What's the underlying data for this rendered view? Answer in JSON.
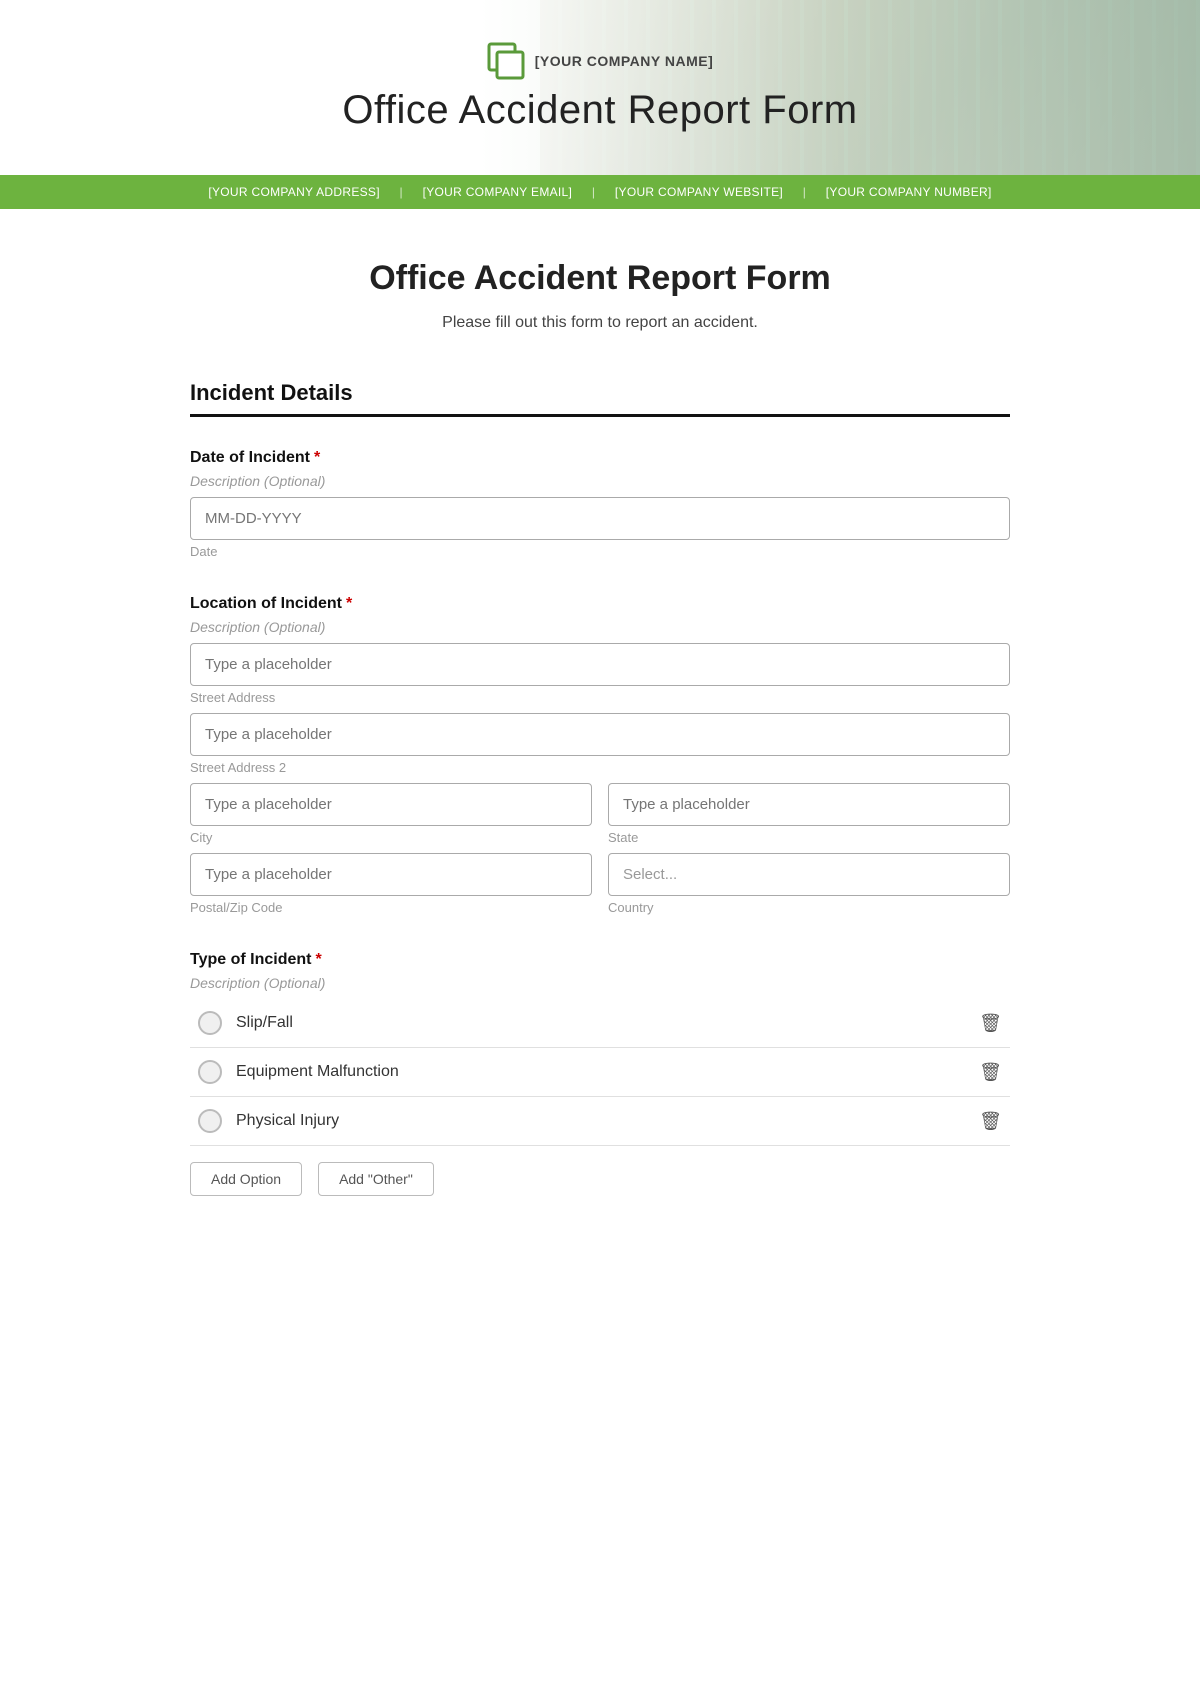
{
  "header": {
    "company_name": "[YOUR COMPANY NAME]",
    "title": "Office Accident Report Form",
    "company_address": "[YOUR COMPANY ADDRESS]",
    "company_email": "[YOUR COMPANY EMAIL]",
    "company_website": "[YOUR COMPANY WEBSITE]",
    "company_number": "[YOUR COMPANY NUMBER]",
    "separator": "|"
  },
  "form": {
    "title": "Office Accident Report Form",
    "subtitle": "Please fill out this form to report an accident.",
    "section_incident": "Incident Details",
    "date_field": {
      "label": "Date of Incident",
      "required": true,
      "description": "Description (Optional)",
      "placeholder": "MM-DD-YYYY",
      "sublabel": "Date"
    },
    "location_field": {
      "label": "Location of Incident",
      "required": true,
      "description": "Description (Optional)",
      "street1_placeholder": "Type a placeholder",
      "street1_sublabel": "Street Address",
      "street2_placeholder": "Type a placeholder",
      "street2_sublabel": "Street Address 2",
      "city_placeholder": "Type a placeholder",
      "city_sublabel": "City",
      "state_placeholder": "Type a placeholder",
      "state_sublabel": "State",
      "zip_placeholder": "Type a placeholder",
      "zip_sublabel": "Postal/Zip Code",
      "country_placeholder": "Select...",
      "country_sublabel": "Country"
    },
    "type_field": {
      "label": "Type of Incident",
      "required": true,
      "description": "Description (Optional)",
      "options": [
        {
          "id": "slip_fall",
          "label": "Slip/Fall"
        },
        {
          "id": "equipment_malfunction",
          "label": "Equipment Malfunction"
        },
        {
          "id": "physical_injury",
          "label": "Physical Injury"
        }
      ],
      "add_option_label": "Add Option",
      "add_other_label": "Add \"Other\""
    }
  },
  "icons": {
    "logo": "⬜",
    "trash": "🗑",
    "calendar": "📅"
  }
}
